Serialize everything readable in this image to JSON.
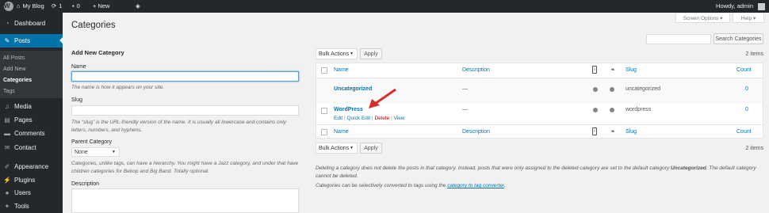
{
  "admin_bar": {
    "site_name": "My Blog",
    "updates_count": "1",
    "comments_count": "0",
    "new_label": "+ New",
    "greeting": "Howdy, admin"
  },
  "sidebar": {
    "items": [
      {
        "label": "Dashboard",
        "icon": "dashboard-icon"
      },
      {
        "label": "Posts",
        "icon": "pin-icon"
      },
      {
        "label": "Media",
        "icon": "media-icon"
      },
      {
        "label": "Pages",
        "icon": "pages-icon"
      },
      {
        "label": "Comments",
        "icon": "comments-icon"
      },
      {
        "label": "Contact",
        "icon": "mail-icon"
      },
      {
        "label": "Appearance",
        "icon": "brush-icon"
      },
      {
        "label": "Plugins",
        "icon": "plug-icon"
      },
      {
        "label": "Users",
        "icon": "users-icon"
      },
      {
        "label": "Tools",
        "icon": "wrench-icon"
      }
    ],
    "submenu": [
      "All Posts",
      "Add New",
      "Categories",
      "Tags"
    ]
  },
  "page": {
    "title": "Categories",
    "screen_options": "Screen Options ▾",
    "help": "Help ▾",
    "search_button": "Search Categories",
    "search_value": ""
  },
  "form": {
    "heading": "Add New Category",
    "name_label": "Name",
    "name_value": "",
    "name_hint": "The name is how it appears on your site.",
    "slug_label": "Slug",
    "slug_value": "",
    "slug_hint": "The “slug” is the URL-friendly version of the name. It is usually all lowercase and contains only letters, numbers, and hyphens.",
    "parent_label": "Parent Category",
    "parent_value": "None",
    "parent_hint": "Categories, unlike tags, can have a hierarchy. You might have a Jazz category, and under that have children categories for Bebop and Big Band. Totally optional.",
    "description_label": "Description"
  },
  "table": {
    "bulk_actions": "Bulk Actions",
    "apply": "Apply",
    "items_count": "2 items",
    "columns": {
      "name": "Name",
      "description": "Description",
      "slug": "Slug",
      "count": "Count"
    },
    "rows": [
      {
        "name": "Uncategorized",
        "description": "—",
        "slug": "uncategorized",
        "count": "0"
      },
      {
        "name": "WordPress",
        "description": "—",
        "slug": "wordpress",
        "count": "0"
      }
    ],
    "row_actions": {
      "edit": "Edit",
      "quick_edit": "Quick Edit",
      "delete": "Delete",
      "view": "View"
    }
  },
  "notes": {
    "delete_note_1": "Deleting a category does not delete the posts in that category. Instead, posts that were only assigned to the deleted category are set to the default category ",
    "default_category": "Uncategorized",
    "delete_note_2": ". The default category cannot be deleted.",
    "convert_note": "Categories can be selectively converted to tags using the ",
    "convert_link": "category to tag converter",
    "convert_end": "."
  },
  "colors": {
    "admin_bar_bg": "#23282d",
    "active_menu": "#0073aa",
    "link": "#0073aa",
    "delete": "#a00",
    "arrow": "#d32f2f"
  }
}
